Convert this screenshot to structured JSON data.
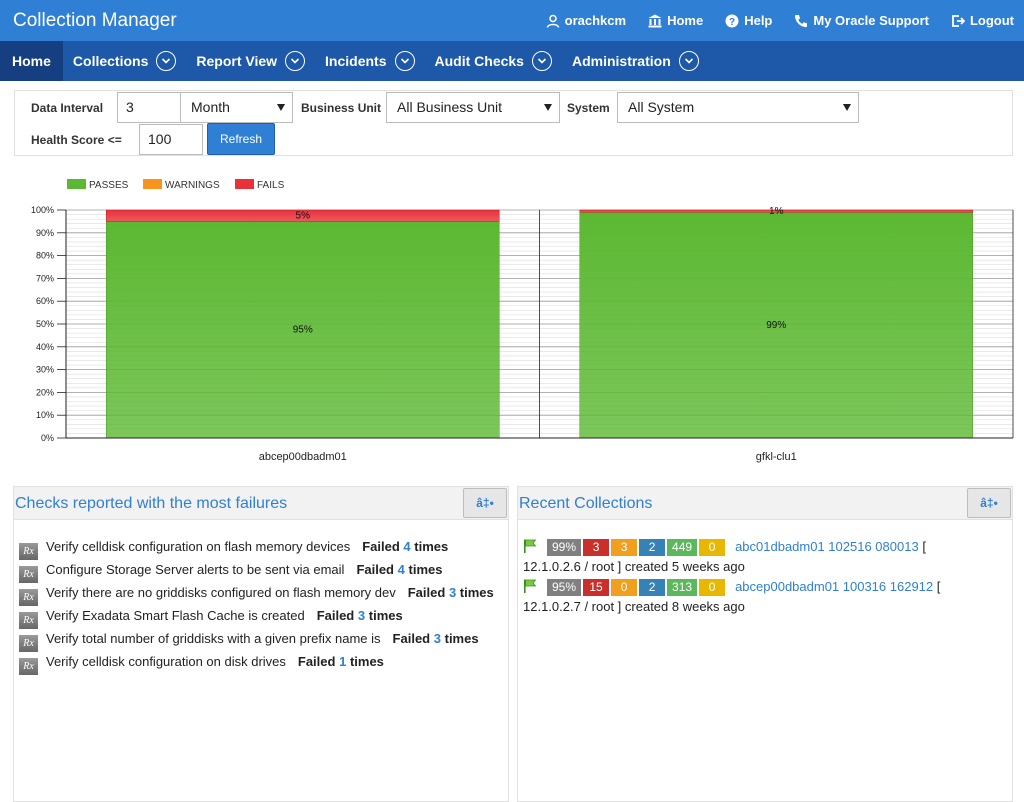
{
  "app": {
    "title": "Collection Manager"
  },
  "toplinks": {
    "user": "orachkcm",
    "home": "Home",
    "help": "Help",
    "support": "My Oracle Support",
    "logout": "Logout"
  },
  "nav": {
    "items": [
      {
        "label": "Home",
        "active": true
      },
      {
        "label": "Collections"
      },
      {
        "label": "Report View"
      },
      {
        "label": "Incidents"
      },
      {
        "label": "Audit Checks"
      },
      {
        "label": "Administration"
      }
    ]
  },
  "filters": {
    "data_interval_label": "Data Interval",
    "data_interval_value": "3",
    "period_value": "Month",
    "business_unit_label": "Business Unit",
    "business_unit_value": "All Business Unit",
    "system_label": "System",
    "system_value": "All System",
    "health_score_label": "Health Score <=",
    "health_score_value": "100",
    "refresh_label": "Refresh"
  },
  "chart_data": {
    "type": "bar",
    "stacked": true,
    "categories": [
      "abcep00dbadm01",
      "gfkl-clu1"
    ],
    "series": [
      {
        "name": "PASSES",
        "color": "#5cb832",
        "values": [
          95,
          99
        ]
      },
      {
        "name": "WARNINGS",
        "color": "#f7941d",
        "values": [
          0,
          0
        ]
      },
      {
        "name": "FAILS",
        "color": "#e8313b",
        "values": [
          5,
          1
        ]
      }
    ],
    "data_labels": [
      {
        "category": "abcep00dbadm01",
        "series": "PASSES",
        "text": "95%"
      },
      {
        "category": "abcep00dbadm01",
        "series": "FAILS",
        "text": "5%"
      },
      {
        "category": "gfkl-clu1",
        "series": "PASSES",
        "text": "99%"
      },
      {
        "category": "gfkl-clu1",
        "series": "FAILS",
        "text": "1%"
      }
    ],
    "yticks": [
      "0%",
      "10%",
      "20%",
      "30%",
      "40%",
      "50%",
      "60%",
      "70%",
      "80%",
      "90%",
      "100%"
    ],
    "ylim": [
      0,
      100
    ],
    "legend": "top-left",
    "grid": true
  },
  "panels": {
    "checks_title": "Checks reported with the most failures",
    "recent_title": "Recent Collections",
    "rx_icon": "Rx"
  },
  "checks": [
    {
      "text": "Verify celldisk configuration on flash memory devices",
      "failed": "Failed",
      "count": "4",
      "times": "times"
    },
    {
      "text": "Configure Storage Server alerts to be sent via email",
      "failed": "Failed",
      "count": "4",
      "times": "times"
    },
    {
      "text": "Verify there are no griddisks configured on flash memory dev",
      "failed": "Failed",
      "count": "3",
      "times": "times"
    },
    {
      "text": "Verify Exadata Smart Flash Cache is created",
      "failed": "Failed",
      "count": "3",
      "times": "times"
    },
    {
      "text": "Verify total number of griddisks with a given prefix name is",
      "failed": "Failed",
      "count": "3",
      "times": "times"
    },
    {
      "text": "Verify celldisk configuration on disk drives",
      "failed": "Failed",
      "count": "1",
      "times": "times"
    }
  ],
  "collections": [
    {
      "score": "99%",
      "fail": "3",
      "warn": "3",
      "info": "2",
      "pass": "449",
      "other": "0",
      "link": "abc01dbadm01 102516 080013",
      "open": "[",
      "details": "12.1.0.2.6 / root ] created 5 weeks ago"
    },
    {
      "score": "95%",
      "fail": "15",
      "warn": "0",
      "info": "2",
      "pass": "313",
      "other": "0",
      "link": "abcep00dbadm01 100316 162912",
      "open": "[",
      "details": "12.1.0.2.7 / root ] created 8 weeks ago"
    }
  ]
}
